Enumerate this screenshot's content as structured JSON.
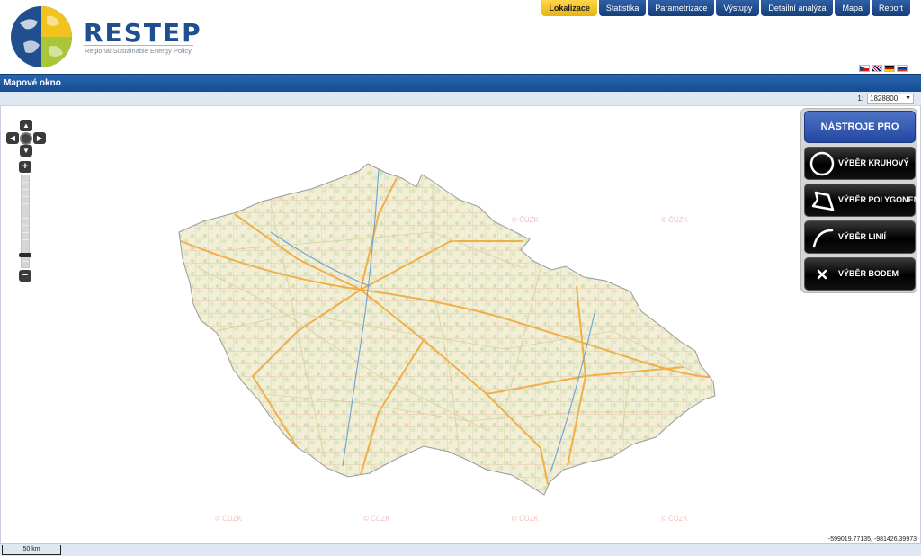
{
  "brand": {
    "title": "RESTEP",
    "subtitle": "Regional Sustainable Energy Policy"
  },
  "nav": {
    "items": [
      "Lokalizace",
      "Statistika",
      "Parametrizace",
      "Výstupy",
      "Detailní analýza",
      "Mapa",
      "Report"
    ],
    "active": "Lokalizace"
  },
  "languages": [
    "cz-flag-icon",
    "gb-flag-icon",
    "de-flag-icon",
    "ru-flag-icon"
  ],
  "panel": {
    "title": "Mapové okno"
  },
  "scale": {
    "prefix": "1:",
    "value": "1828800"
  },
  "watermark": "© ČÚZK",
  "tools": {
    "title": "NÁSTROJE PRO VÝBĚR",
    "circle": "VÝBĚR KRUHOVÝ",
    "polygon": "VÝBĚR POLYGONEM",
    "line": "VÝBĚR LINIÍ",
    "point": "VÝBĚR BODEM"
  },
  "coordinates": "-599019.77135, -981426.39973",
  "scale_ruler": "50 km",
  "colors": {
    "brand_blue": "#1f4f8f",
    "active_tab": "#f2c21f",
    "titlebar": "#1d5aa3"
  }
}
